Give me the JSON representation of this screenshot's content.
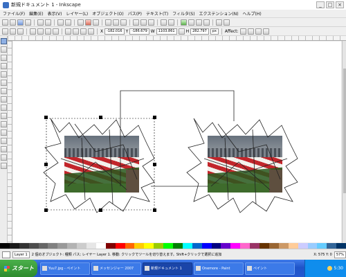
{
  "window": {
    "title": "新規ドキュメント 1 - Inkscape"
  },
  "menubar": {
    "items": [
      "ファイル(F)",
      "編集(E)",
      "表示(V)",
      "レイヤー(L)",
      "オブジェクト(O)",
      "パス(P)",
      "テキスト(T)",
      "フィルタ(S)",
      "エクステンション(N)",
      "ヘルプ(H)"
    ]
  },
  "toolbar2": {
    "x_label": "X",
    "x_value": "-182.016",
    "y_label": "Y",
    "y_value": "-186.679",
    "w_label": "W",
    "w_value": "1103.861",
    "h_label": "H",
    "h_value": "282.797",
    "unit": "px",
    "affect_label": "Affect:"
  },
  "palette": {
    "colors": [
      "#000000",
      "#1a1a1a",
      "#333333",
      "#4d4d4d",
      "#666666",
      "#808080",
      "#999999",
      "#b3b3b3",
      "#cccccc",
      "#e6e6e6",
      "#ffffff",
      "#800000",
      "#ff0000",
      "#ff6600",
      "#ffcc00",
      "#ffff00",
      "#99cc00",
      "#00ff00",
      "#008000",
      "#00ffff",
      "#0066cc",
      "#0000ff",
      "#000080",
      "#6600cc",
      "#ff00ff",
      "#ff66cc",
      "#993366",
      "#663300",
      "#996633",
      "#cc9966",
      "#ffcc99",
      "#ccccff",
      "#99ccff",
      "#66ccff",
      "#336699",
      "#003366"
    ]
  },
  "status": {
    "layer": "Layer 1",
    "message": "2 個のオブジェクト: 種類 パス; レイヤー Layer 1. 移動: クリックでツールを切り替えます。Shift+クリックで選択に追加",
    "coords": "X: 575   Y: 0",
    "zoom": "57%"
  },
  "taskbar": {
    "start": "スタート",
    "tasks": [
      {
        "label": "Yuu7.jpg - ペイント",
        "active": false
      },
      {
        "label": "メッセンジャー 2007",
        "active": false
      },
      {
        "label": "新規ドキュメント 1",
        "active": true
      },
      {
        "label": "Onemore - Paint",
        "active": false
      },
      {
        "label": "ペイント",
        "active": false
      }
    ],
    "clock": "5:30"
  }
}
